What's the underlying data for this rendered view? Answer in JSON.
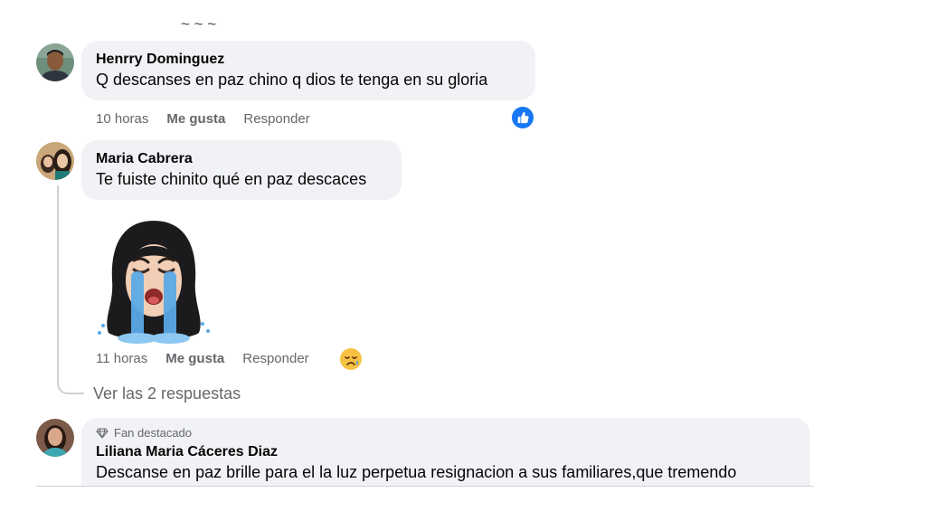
{
  "comments": [
    {
      "author": "Henrry Dominguez",
      "text": "Q descanses en paz chino q dios te tenga en su gloria",
      "time": "10 horas",
      "like_label": "Me gusta",
      "reply_label": "Responder",
      "reaction_icon": "like-icon",
      "reaction_color": "#1877f2"
    },
    {
      "author": "Maria Cabrera",
      "text": "Te fuiste chinito qué en paz descaces",
      "sticker": "crying-woman-sticker",
      "time": "11 horas",
      "like_label": "Me gusta",
      "reply_label": "Responder",
      "reaction_icon": "sad-tear-emoji-icon",
      "replies_link": "Ver las 2 respuestas"
    },
    {
      "badge": "Fan destacado",
      "badge_icon": "diamond-icon",
      "author": "Liliana Maria Cáceres Diaz",
      "text": "Descanse en paz brille para el la luz perpetua resignacion a sus familiares,que tremendo"
    }
  ]
}
